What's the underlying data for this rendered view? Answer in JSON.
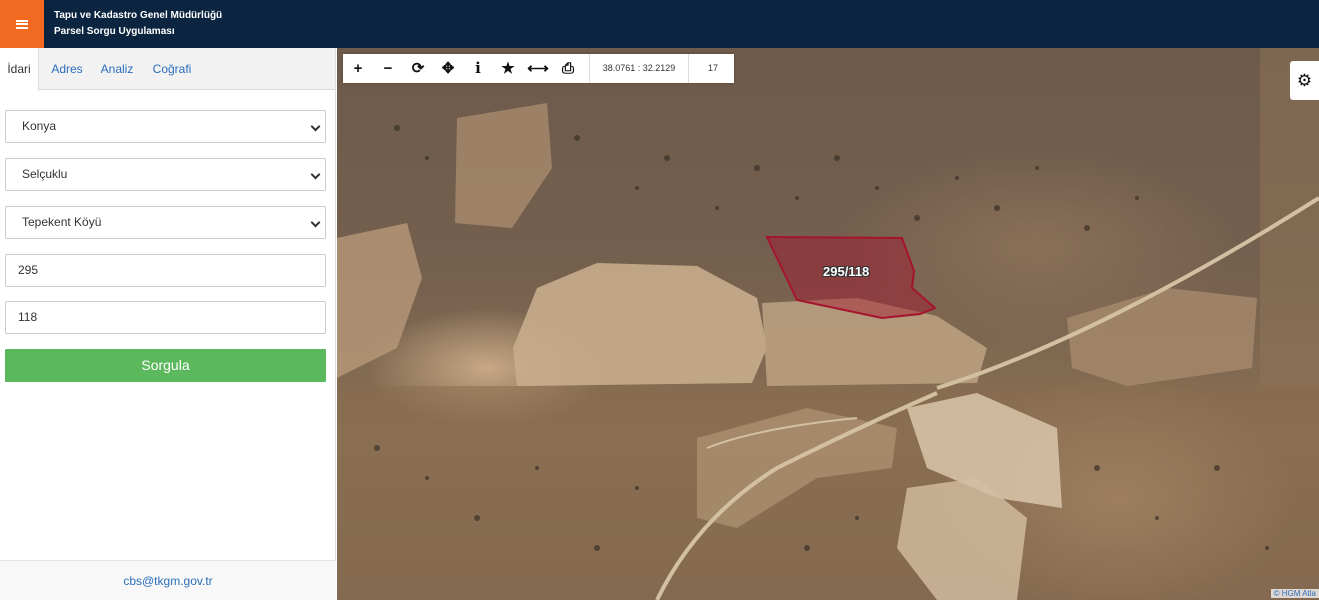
{
  "header": {
    "title_line1": "Tapu ve Kadastro Genel Müdürlüğü",
    "title_line2": "Parsel Sorgu Uygulaması",
    "menu_icon": "hamburger-icon",
    "accent_color": "#f26a21",
    "bar_color": "#0b2540"
  },
  "sidebar": {
    "tabs": [
      {
        "label": "İdari",
        "active": true
      },
      {
        "label": "Adres",
        "active": false
      },
      {
        "label": "Analiz",
        "active": false
      },
      {
        "label": "Coğrafi",
        "active": false
      }
    ],
    "province": "Konya",
    "district": "Selçuklu",
    "neighborhood": "Tepekent Köyü",
    "block": "295",
    "parcel": "118",
    "submit_label": "Sorgula",
    "submit_color": "#5cb85c",
    "footer_email": "cbs@tkgm.gov.tr"
  },
  "toolbar": {
    "tools": [
      {
        "icon": "zoom-in-icon",
        "glyph": "+"
      },
      {
        "icon": "zoom-out-icon",
        "glyph": "−"
      },
      {
        "icon": "refresh-icon",
        "glyph": "⟳"
      },
      {
        "icon": "locate-icon",
        "glyph": "✥"
      },
      {
        "icon": "info-icon",
        "glyph": "i"
      },
      {
        "icon": "star-icon",
        "glyph": "★"
      },
      {
        "icon": "measure-icon",
        "glyph": "⟷"
      },
      {
        "icon": "print-icon",
        "glyph": "⎙"
      }
    ],
    "coordinates": "38.0761 : 32.2129",
    "zoom_level": "17"
  },
  "map": {
    "parcel_label": "295/118",
    "parcel_color": "#a5142e",
    "settings_icon": "gear-icon",
    "attribution": "© HGM Atla"
  }
}
